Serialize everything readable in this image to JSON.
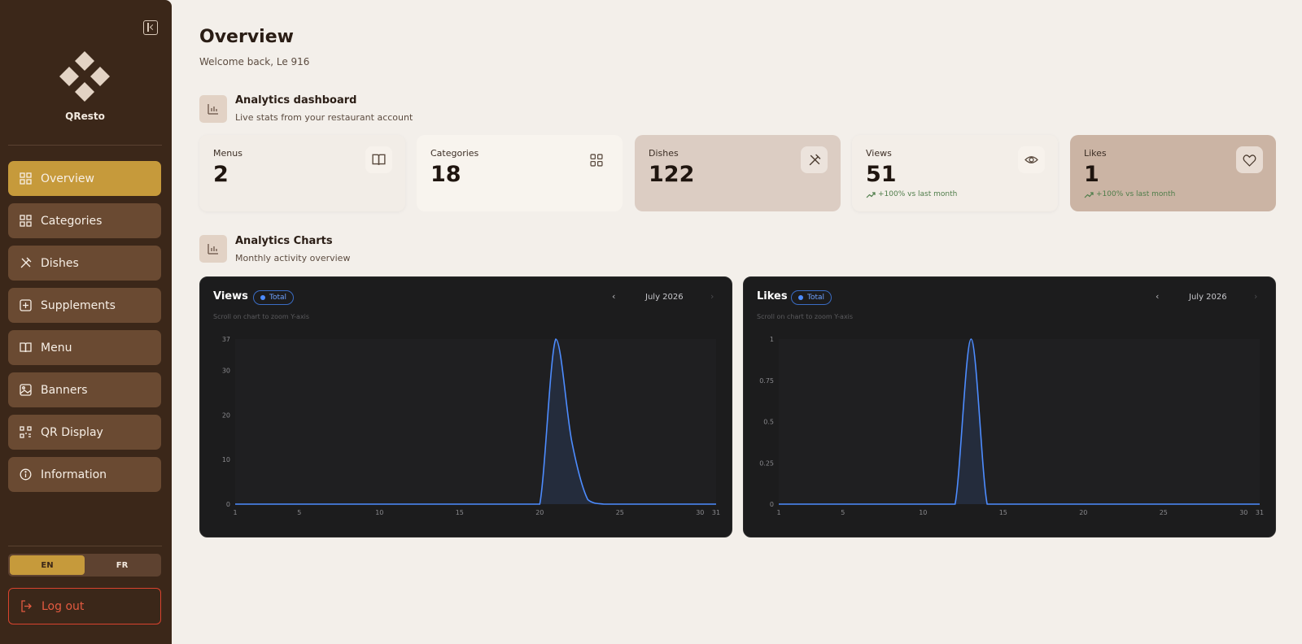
{
  "sidebar": {
    "brand": "QResto",
    "items": [
      {
        "label": "Overview",
        "icon": "grid-icon"
      },
      {
        "label": "Categories",
        "icon": "grid-icon"
      },
      {
        "label": "Dishes",
        "icon": "utensils-icon"
      },
      {
        "label": "Supplements",
        "icon": "plus-square-icon"
      },
      {
        "label": "Menu",
        "icon": "book-icon"
      },
      {
        "label": "Banners",
        "icon": "image-icon"
      },
      {
        "label": "QR Display",
        "icon": "qr-icon"
      },
      {
        "label": "Information",
        "icon": "info-icon"
      }
    ],
    "lang": {
      "en": "EN",
      "fr": "FR",
      "active": "EN"
    },
    "logout": "Log out"
  },
  "header": {
    "title": "Overview",
    "subtitle": "Welcome back, Le 916"
  },
  "analytics": {
    "title": "Analytics dashboard",
    "subtitle": "Live stats from your restaurant account"
  },
  "cards": [
    {
      "label": "Menus",
      "value": "2",
      "icon": "book-icon"
    },
    {
      "label": "Categories",
      "value": "18",
      "icon": "grid-icon"
    },
    {
      "label": "Dishes",
      "value": "122",
      "icon": "utensils-icon"
    },
    {
      "label": "Views",
      "value": "51",
      "icon": "eye-icon",
      "trend": "+100% vs last month"
    },
    {
      "label": "Likes",
      "value": "1",
      "icon": "heart-icon",
      "trend": "+100% vs last month"
    }
  ],
  "charts_section": {
    "title": "Analytics Charts",
    "subtitle": "Monthly activity overview"
  },
  "colors": {
    "sidebar": "#3b2719",
    "accent": "#c69a3b",
    "line": "#4d8cff",
    "chart_bg": "#1c1c1d"
  },
  "chart_panels": [
    {
      "title": "Views",
      "badge": "Total",
      "hint": "Scroll on chart to zoom Y-axis",
      "month": "July 2026",
      "prev": "‹",
      "next": "›"
    },
    {
      "title": "Likes",
      "badge": "Total",
      "hint": "Scroll on chart to zoom Y-axis",
      "month": "July 2026",
      "prev": "‹",
      "next": "›"
    }
  ],
  "chart_data": [
    {
      "type": "area",
      "title": "Views",
      "x": [
        1,
        2,
        3,
        4,
        5,
        6,
        7,
        8,
        9,
        10,
        11,
        12,
        13,
        14,
        15,
        16,
        17,
        18,
        19,
        20,
        21,
        22,
        23,
        24,
        25,
        26,
        27,
        28,
        29,
        30,
        31
      ],
      "series": [
        {
          "name": "Total",
          "values": [
            0,
            0,
            0,
            0,
            0,
            0,
            0,
            0,
            0,
            0,
            0,
            0,
            0,
            0,
            0,
            0,
            0,
            0,
            0,
            0,
            37,
            14,
            1,
            0,
            0,
            0,
            0,
            0,
            0,
            0,
            0
          ]
        }
      ],
      "ylim": [
        0,
        37
      ],
      "yticks": [
        0,
        10,
        20,
        30,
        37
      ],
      "xticks": [
        1,
        5,
        10,
        15,
        20,
        25,
        30,
        31
      ]
    },
    {
      "type": "area",
      "title": "Likes",
      "x": [
        1,
        2,
        3,
        4,
        5,
        6,
        7,
        8,
        9,
        10,
        11,
        12,
        13,
        14,
        15,
        16,
        17,
        18,
        19,
        20,
        21,
        22,
        23,
        24,
        25,
        26,
        27,
        28,
        29,
        30,
        31
      ],
      "series": [
        {
          "name": "Total",
          "values": [
            0,
            0,
            0,
            0,
            0,
            0,
            0,
            0,
            0,
            0,
            0,
            0,
            1,
            0,
            0,
            0,
            0,
            0,
            0,
            0,
            0,
            0,
            0,
            0,
            0,
            0,
            0,
            0,
            0,
            0,
            0
          ]
        }
      ],
      "ylim": [
        0,
        1
      ],
      "yticks": [
        0,
        0.25,
        0.5,
        0.75,
        1
      ],
      "xticks": [
        1,
        5,
        10,
        15,
        20,
        25,
        30,
        31
      ]
    }
  ]
}
